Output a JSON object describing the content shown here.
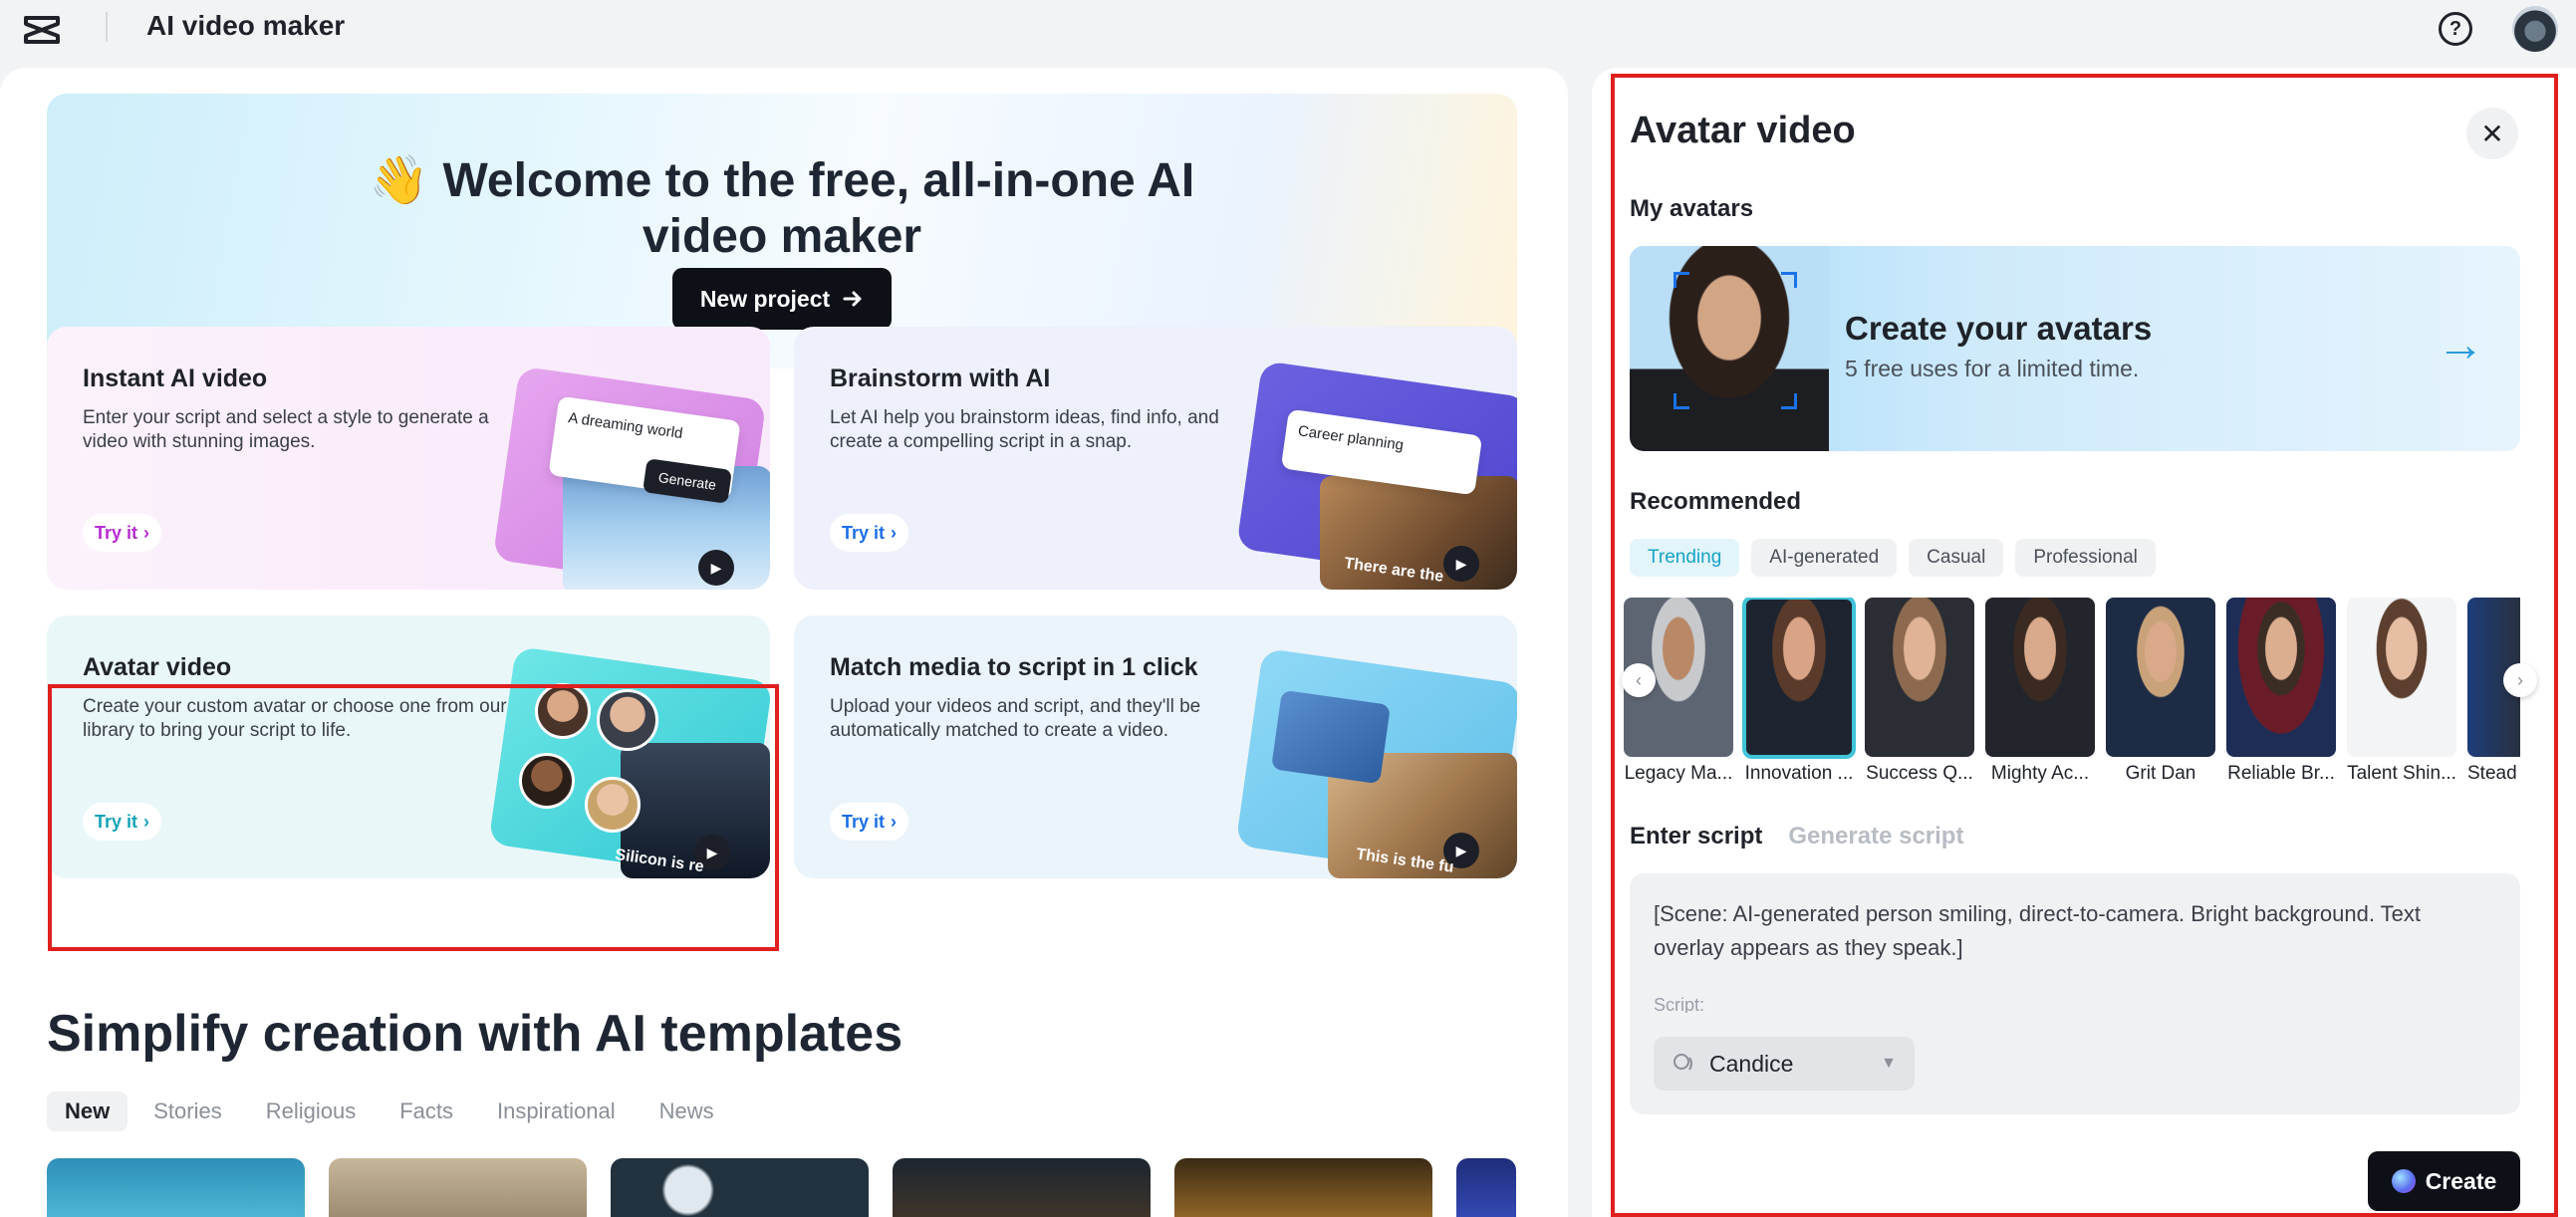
{
  "app": {
    "title": "AI video maker"
  },
  "topbar": {
    "help_icon": "question-circle-icon",
    "avatar_icon": "user-avatar"
  },
  "hero": {
    "emoji": "👋",
    "title_line1": "Welcome to the free, all-in-one AI",
    "title_line2": "video maker",
    "button_label": "New project"
  },
  "cards": [
    {
      "title": "Instant AI video",
      "desc": "Enter your script and select a style to generate a video with stunning images.",
      "cta": "Try it",
      "art_text": "A dreaming world",
      "art_button": "Generate"
    },
    {
      "title": "Brainstorm with AI",
      "desc": "Let AI help you brainstorm ideas, find info, and create a compelling script in a snap.",
      "cta": "Try it",
      "art_text": "Career planning",
      "art_caption": "There are the"
    },
    {
      "title": "Avatar video",
      "desc": "Create your custom avatar or choose one from our library to bring your script to life.",
      "cta": "Try it",
      "art_caption": "Silicon is re"
    },
    {
      "title": "Match media to script in 1 click",
      "desc": "Upload your videos and script, and they'll be automatically matched to create a video.",
      "cta": "Try it",
      "art_caption": "This is the fu"
    }
  ],
  "templates": {
    "title": "Simplify creation with AI templates",
    "tabs": [
      "New",
      "Stories",
      "Religious",
      "Facts",
      "Inspirational",
      "News"
    ],
    "active_tab": "New"
  },
  "panel": {
    "title": "Avatar video",
    "close_icon": "close-icon",
    "my_avatars_label": "My avatars",
    "create_title": "Create your avatars",
    "create_sub": "5 free uses for a limited time.",
    "recommended_label": "Recommended",
    "rec_tabs": [
      "Trending",
      "AI-generated",
      "Casual",
      "Professional"
    ],
    "avatars": [
      "Legacy Ma...",
      "Innovation ...",
      "Success Q...",
      "Mighty Ac...",
      "Grit Dan",
      "Reliable Br...",
      "Talent Shin...",
      "Stead"
    ],
    "script_tab_active": "Enter script",
    "script_tab_other": "Generate script",
    "script_text": "[Scene: AI-generated person smiling, direct-to-camera. Bright background. Text overlay appears as they speak.]",
    "script_next": "Script:",
    "voice": "Candice",
    "create_label": "Create"
  }
}
